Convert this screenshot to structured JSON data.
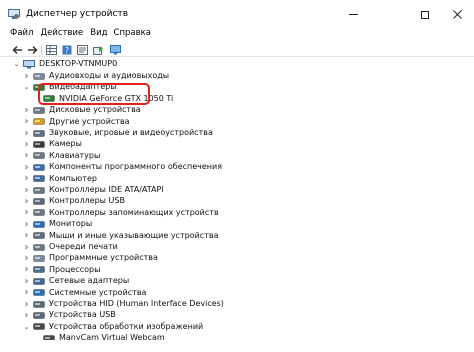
{
  "window": {
    "title": "Диспетчер устройств"
  },
  "menu": [
    "Файл",
    "Действие",
    "Вид",
    "Справка"
  ],
  "tree": {
    "root": "DESKTOP-VTNMUP0",
    "items": [
      {
        "label": "Аудиовходы и аудиовыходы",
        "icon": "audio-icon"
      },
      {
        "label": "Видеоадаптеры",
        "icon": "display-adapter-icon",
        "expanded": true
      },
      {
        "label": "NVIDIA GeForce GTX 1050 Ti",
        "icon": "display-adapter-icon",
        "child": true
      },
      {
        "label": "Дисковые устройства",
        "icon": "disk-icon"
      },
      {
        "label": "Другие устройства",
        "icon": "other-device-icon"
      },
      {
        "label": "Звуковые, игровые и видеоустройства",
        "icon": "sound-icon"
      },
      {
        "label": "Камеры",
        "icon": "camera-icon"
      },
      {
        "label": "Клавиатуры",
        "icon": "keyboard-icon"
      },
      {
        "label": "Компоненты программного обеспечения",
        "icon": "software-icon"
      },
      {
        "label": "Компьютер",
        "icon": "computer-icon"
      },
      {
        "label": "Контроллеры IDE ATA/ATAPI",
        "icon": "controller-icon"
      },
      {
        "label": "Контроллеры USB",
        "icon": "usb-icon"
      },
      {
        "label": "Контроллеры запоминающих устройств",
        "icon": "storage-icon"
      },
      {
        "label": "Мониторы",
        "icon": "monitor-icon"
      },
      {
        "label": "Мыши и иные указывающие устройства",
        "icon": "mouse-icon"
      },
      {
        "label": "Очереди печати",
        "icon": "printer-icon"
      },
      {
        "label": "Программные устройства",
        "icon": "software-device-icon"
      },
      {
        "label": "Процессоры",
        "icon": "processor-icon"
      },
      {
        "label": "Сетевые адаптеры",
        "icon": "network-icon"
      },
      {
        "label": "Системные устройства",
        "icon": "system-icon"
      },
      {
        "label": "Устройства HID (Human Interface Devices)",
        "icon": "hid-icon"
      },
      {
        "label": "Устройства USB",
        "icon": "usb-device-icon"
      },
      {
        "label": "Устройства обработки изображений",
        "icon": "imaging-icon",
        "expanded": true
      },
      {
        "label": "ManyCam Virtual Webcam",
        "icon": "webcam-icon",
        "child": true
      }
    ]
  },
  "colors": {
    "highlight": "#e0211e",
    "accent": "#2a6fbf"
  }
}
